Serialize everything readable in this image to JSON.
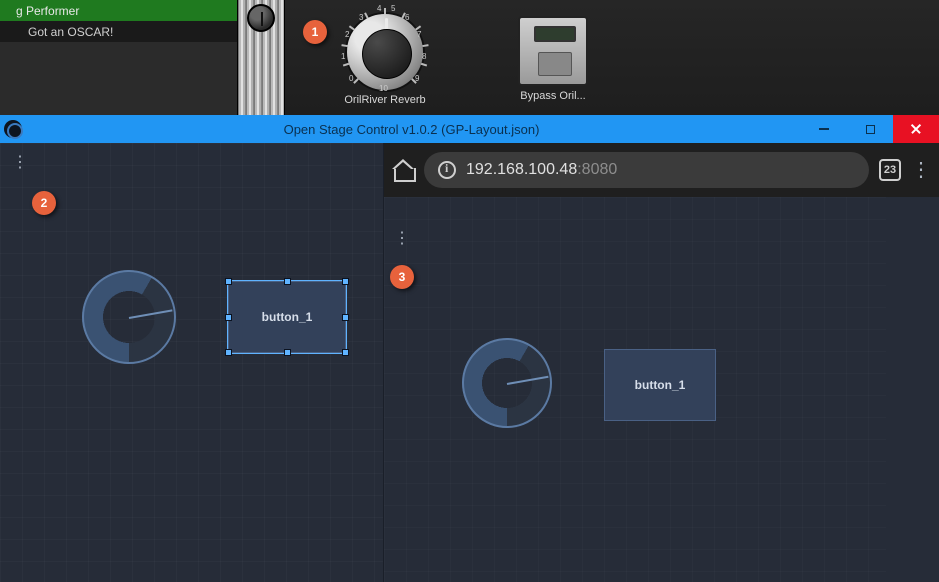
{
  "host": {
    "rack_row_active": "g Performer",
    "rack_row_sub": "Got an OSCAR!",
    "slot1_label": "OrilRiver Reverb",
    "slot2_label": "Bypass Oril..."
  },
  "callouts": {
    "one": "1",
    "two": "2",
    "three": "3"
  },
  "osc": {
    "title": "Open Stage Control v1.0.2 (GP-Layout.json)",
    "button_label": "button_1"
  },
  "browser": {
    "ip": "192.168.100.48",
    "port": ":8080",
    "tab_count": "23",
    "button_label": "button_1"
  }
}
